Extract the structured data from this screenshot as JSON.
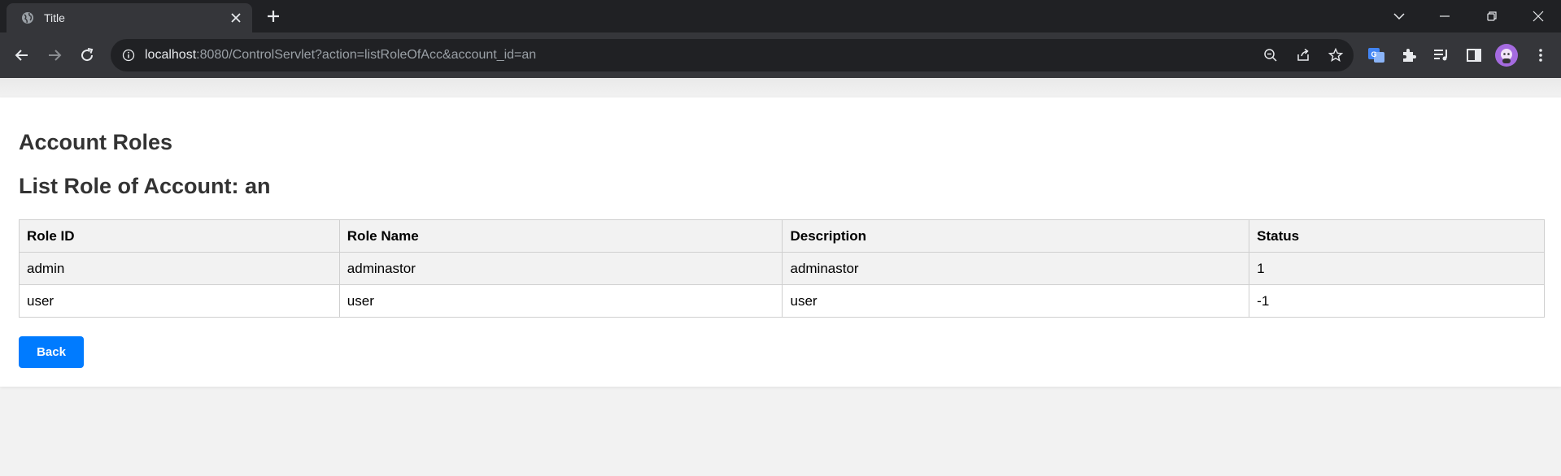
{
  "browser": {
    "tab_title": "Title",
    "url_host": "localhost",
    "url_rest": ":8080/ControlServlet?action=listRoleOfAcc&account_id=an",
    "icons": {
      "favicon": "globe-icon",
      "close": "close-icon",
      "new_tab": "plus-icon",
      "tab_search": "chevron-down-icon",
      "minimize": "minimize-icon",
      "restore": "restore-icon",
      "window_close": "window-close-icon",
      "back": "arrow-left-icon",
      "forward": "arrow-right-icon",
      "reload": "reload-icon",
      "site_info": "info-icon",
      "zoom": "zoom-out-icon",
      "share": "share-icon",
      "bookmark": "star-icon",
      "translate": "translate-icon",
      "extensions": "puzzle-icon",
      "media": "media-queue-icon",
      "side_panel": "side-panel-icon",
      "profile": "avatar",
      "menu": "kebab-menu-icon"
    },
    "colors": {
      "tabstrip": "#202124",
      "toolbar": "#35363a",
      "omnibox": "#202124",
      "text": "#e8eaed"
    }
  },
  "page": {
    "heading": "Account Roles",
    "subheading": "List Role of Account: an",
    "table": {
      "headers": [
        "Role ID",
        "Role Name",
        "Description",
        "Status"
      ],
      "rows": [
        [
          "admin",
          "adminastor",
          "adminastor",
          "1"
        ],
        [
          "user",
          "user",
          "user",
          "-1"
        ]
      ]
    },
    "back_label": "Back",
    "colors": {
      "accent": "#007bff",
      "heading": "#333333",
      "header_bg": "#f2f2f2",
      "border": "#cfcfcf"
    }
  }
}
